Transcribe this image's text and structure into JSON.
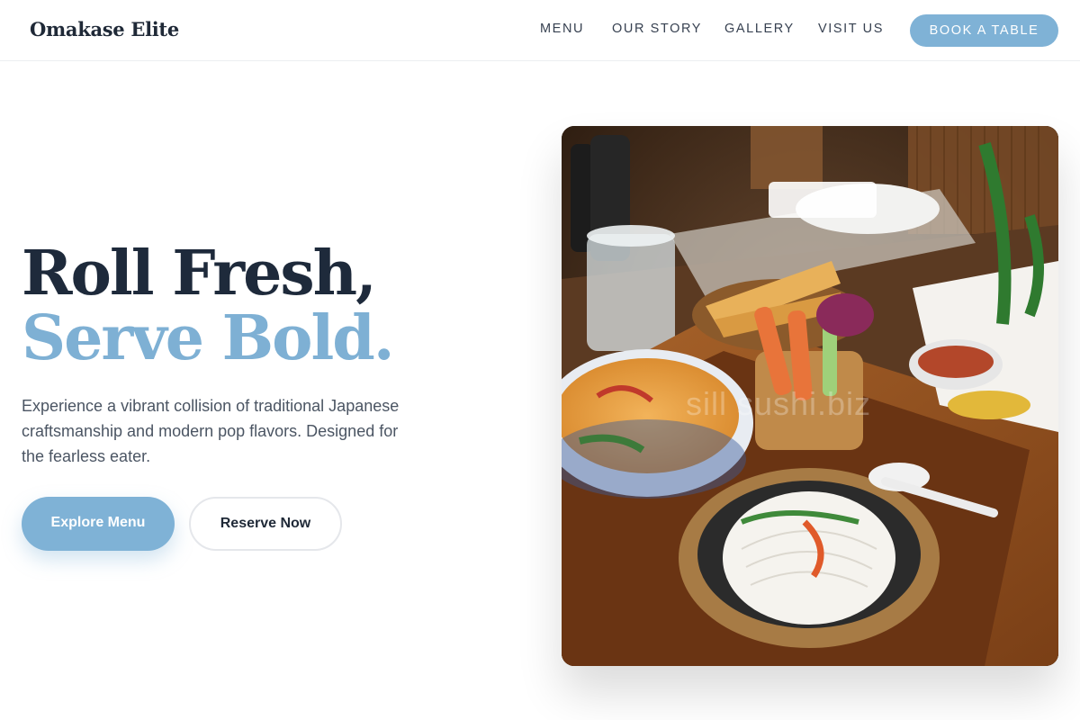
{
  "brand": {
    "name": "Omakase Elite"
  },
  "nav": {
    "items": [
      {
        "label": "MENU"
      },
      {
        "label": "OUR STORY"
      },
      {
        "label": "GALLERY"
      },
      {
        "label": "VISIT US"
      }
    ],
    "cta_label": "BOOK A TABLE"
  },
  "hero": {
    "title_line1": "Roll Fresh,",
    "title_line2": "Serve Bold.",
    "description": "Experience a vibrant collision of traditional Japanese craftsmanship and modern pop flavors. Designed for the fearless eater.",
    "primary_button": "Explore Menu",
    "secondary_button": "Reserve Now",
    "image_watermark": "sill sushi.biz"
  },
  "colors": {
    "accent": "#7fb2d6",
    "heading_dark": "#1e2a3b",
    "body_text": "#4b5563"
  }
}
